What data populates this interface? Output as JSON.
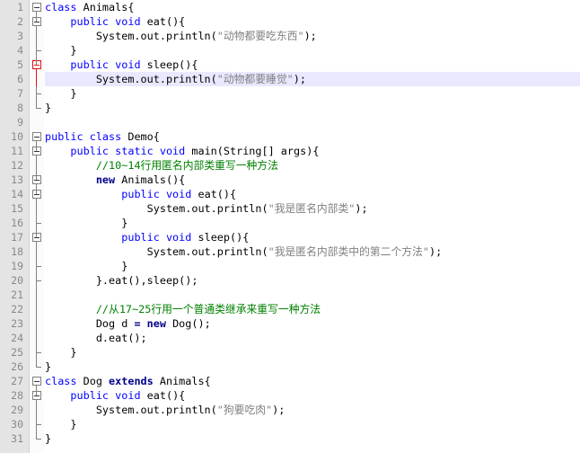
{
  "editor": {
    "current_line": 6,
    "lines": [
      {
        "n": "1",
        "tokens": [
          [
            "kw",
            "class"
          ],
          [
            "",
            "Animals{"
          ]
        ]
      },
      {
        "n": "2",
        "tokens": [
          [
            "",
            "    "
          ],
          [
            "kw",
            "public void"
          ],
          [
            "",
            "eat(){"
          ]
        ]
      },
      {
        "n": "3",
        "tokens": [
          [
            "",
            "        System.out.println("
          ],
          [
            "str",
            "\"动物都要吃东西\""
          ],
          [
            "",
            ");"
          ]
        ]
      },
      {
        "n": "4",
        "tokens": [
          [
            "",
            "    }"
          ]
        ]
      },
      {
        "n": "5",
        "tokens": [
          [
            "",
            "    "
          ],
          [
            "kw",
            "public void"
          ],
          [
            "",
            "sleep(){"
          ]
        ]
      },
      {
        "n": "6",
        "tokens": [
          [
            "",
            "        System.out.println("
          ],
          [
            "str",
            "\"动物都要睡觉\""
          ],
          [
            "",
            ");"
          ]
        ]
      },
      {
        "n": "7",
        "tokens": [
          [
            "",
            "    }"
          ]
        ]
      },
      {
        "n": "8",
        "tokens": [
          [
            "",
            "}"
          ]
        ]
      },
      {
        "n": "9",
        "tokens": []
      },
      {
        "n": "10",
        "tokens": [
          [
            "kw",
            "public class"
          ],
          [
            "",
            "Demo{"
          ]
        ]
      },
      {
        "n": "11",
        "tokens": [
          [
            "",
            "    "
          ],
          [
            "kw",
            "public static void"
          ],
          [
            "",
            "main(String[] args){"
          ]
        ]
      },
      {
        "n": "12",
        "tokens": [
          [
            "",
            "        "
          ],
          [
            "cmt",
            "//10~14行用匿名内部类重写一种方法"
          ]
        ]
      },
      {
        "n": "13",
        "tokens": [
          [
            "",
            "        "
          ],
          [
            "kwb",
            "new"
          ],
          [
            "",
            "Animals(){"
          ]
        ]
      },
      {
        "n": "14",
        "tokens": [
          [
            "",
            "            "
          ],
          [
            "kw",
            "public void"
          ],
          [
            "",
            "eat(){"
          ]
        ]
      },
      {
        "n": "15",
        "tokens": [
          [
            "",
            "                System.out.println("
          ],
          [
            "str",
            "\"我是匿名内部类\""
          ],
          [
            "",
            ");"
          ]
        ]
      },
      {
        "n": "16",
        "tokens": [
          [
            "",
            "            }"
          ]
        ]
      },
      {
        "n": "17",
        "tokens": [
          [
            "",
            "            "
          ],
          [
            "kw",
            "public void"
          ],
          [
            "",
            "sleep(){"
          ]
        ]
      },
      {
        "n": "18",
        "tokens": [
          [
            "",
            "                System.out.println("
          ],
          [
            "str",
            "\"我是匿名内部类中的第二个方法\""
          ],
          [
            "",
            ");"
          ]
        ]
      },
      {
        "n": "19",
        "tokens": [
          [
            "",
            "            }"
          ]
        ]
      },
      {
        "n": "20",
        "tokens": [
          [
            "",
            "        }.eat(),sleep();"
          ]
        ]
      },
      {
        "n": "21",
        "tokens": []
      },
      {
        "n": "22",
        "tokens": [
          [
            "",
            "        "
          ],
          [
            "cmt",
            "//从17~25行用一个普通类继承来重写一种方法"
          ]
        ]
      },
      {
        "n": "23",
        "tokens": [
          [
            "",
            "        Dog d "
          ],
          [
            "op",
            "="
          ],
          [
            "",
            " "
          ],
          [
            "kwb",
            "new"
          ],
          [
            "",
            "Dog();"
          ]
        ]
      },
      {
        "n": "24",
        "tokens": [
          [
            "",
            "        d.eat();"
          ]
        ]
      },
      {
        "n": "25",
        "tokens": [
          [
            "",
            "    }"
          ]
        ]
      },
      {
        "n": "26",
        "tokens": [
          [
            "",
            "}"
          ]
        ]
      },
      {
        "n": "27",
        "tokens": [
          [
            "kw",
            "class"
          ],
          [
            "",
            "Dog "
          ],
          [
            "kwb",
            "extends"
          ],
          [
            "",
            "Animals{"
          ]
        ]
      },
      {
        "n": "28",
        "tokens": [
          [
            "",
            "    "
          ],
          [
            "kw",
            "public void"
          ],
          [
            "",
            "eat(){"
          ]
        ]
      },
      {
        "n": "29",
        "tokens": [
          [
            "",
            "        System.out.println("
          ],
          [
            "str",
            "\"狗要吃肉\""
          ],
          [
            "",
            ");"
          ]
        ]
      },
      {
        "n": "30",
        "tokens": [
          [
            "",
            "    }"
          ]
        ]
      },
      {
        "n": "31",
        "tokens": [
          [
            "",
            "}"
          ]
        ]
      }
    ]
  },
  "colors": {
    "keyword": "#0000ff",
    "keyword_bold": "#00008b",
    "string": "#808080",
    "comment": "#008000",
    "current_line": "#e8e8ff",
    "gutter": "#e4e4e4"
  }
}
